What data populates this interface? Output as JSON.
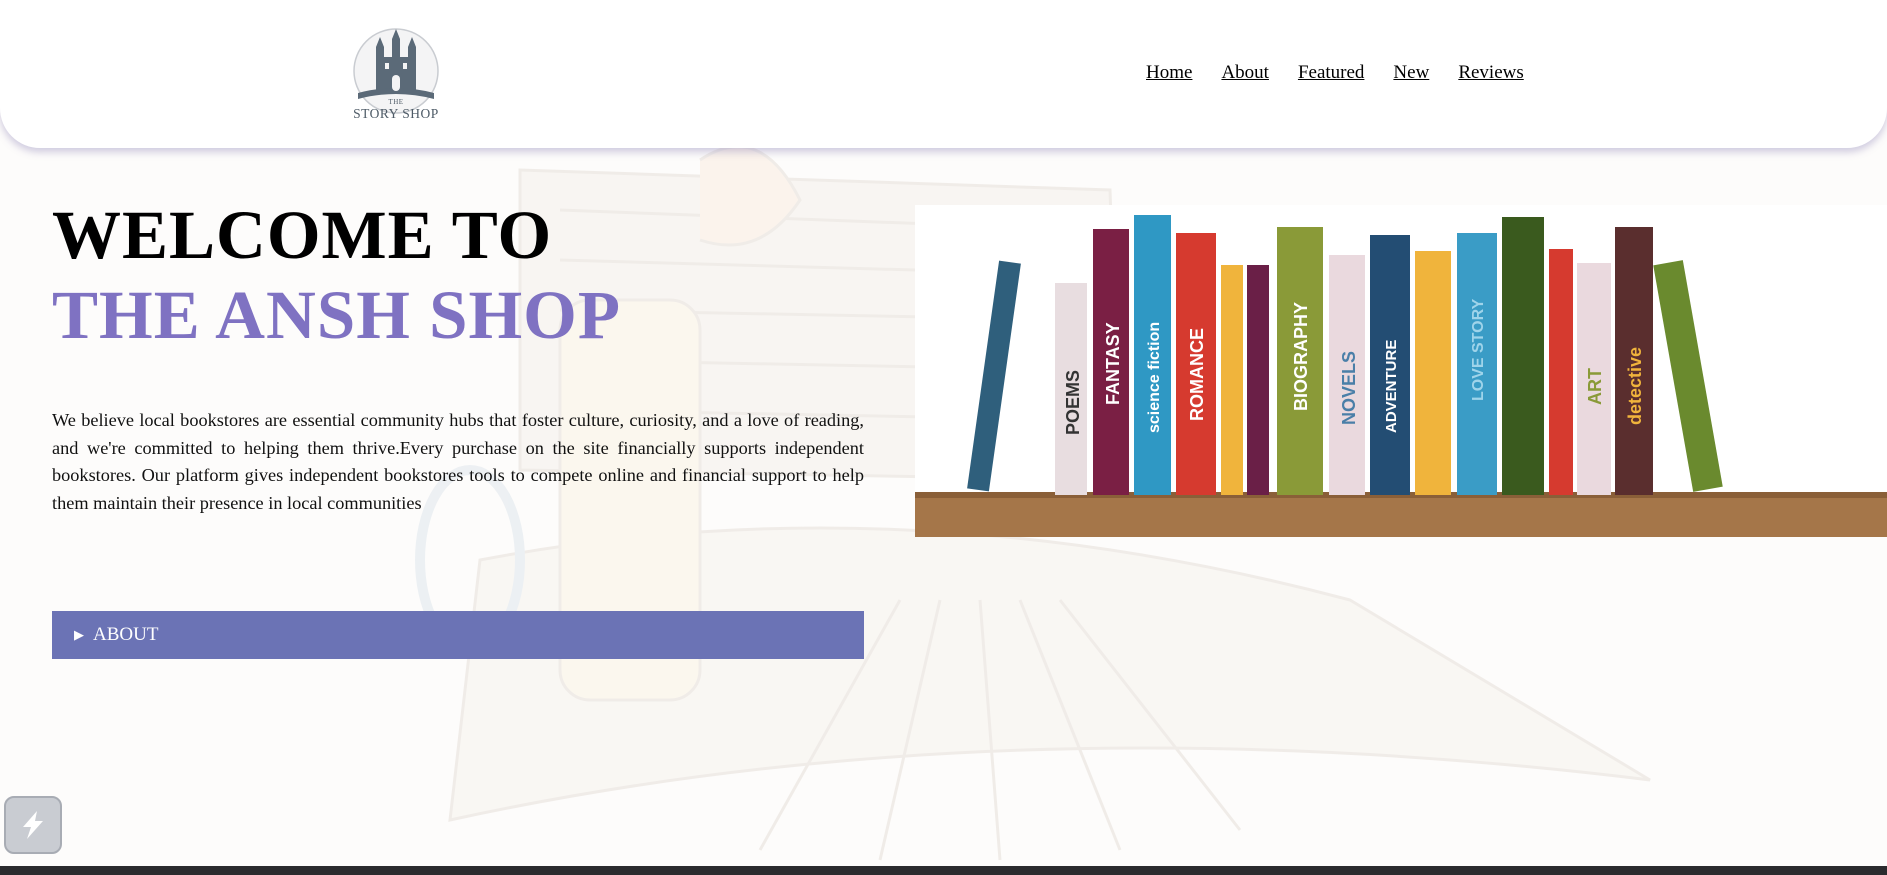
{
  "header": {
    "logo_text": "STORY SHOP",
    "logo_small": "THE",
    "nav": [
      "Home",
      "About",
      "Featured",
      "New",
      "Reviews"
    ]
  },
  "hero": {
    "title_line1": "WELCOME TO",
    "title_line2": "THE ANSH SHOP",
    "description": "We believe local bookstores are essential community hubs that foster culture, curiosity, and a love of reading, and we're committed to helping them thrive.Every purchase on the site financially supports independent bookstores. Our platform gives independent bookstores tools to compete online and financial support to help them maintain their presence in local communities"
  },
  "about_bar": {
    "label": "ABOUT",
    "state": "collapsed"
  },
  "bookshelf": {
    "spine_labels": [
      "POEMS",
      "FANTASY",
      "science fiction",
      "ROMANCE",
      "BIOGRAPHY",
      "NOVELS",
      "ADVENTURE",
      "LOVE STORY",
      "ART",
      "detective"
    ]
  },
  "colors": {
    "accent": "#7f72c2",
    "about_bar": "#6b73b5",
    "shelf_wood": "#a57649"
  }
}
